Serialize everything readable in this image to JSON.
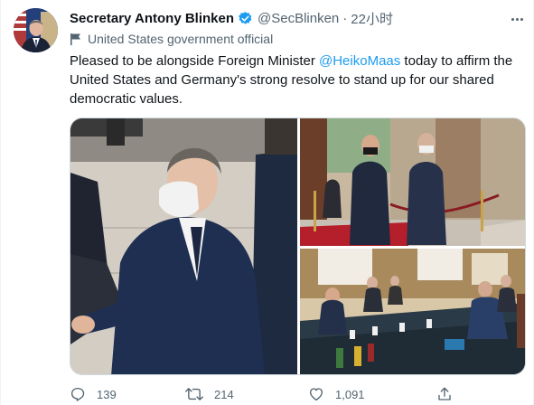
{
  "tweet": {
    "author_name": "Secretary Antony Blinken",
    "handle": "@SecBlinken",
    "separator": "·",
    "time": "22小时",
    "label": "United States government official",
    "text_before": "Pleased to be alongside Foreign Minister ",
    "mention": "@HeikoMaas",
    "text_after": " today to affirm the United States and Germany's strong resolve to stand up for our shared democratic values."
  },
  "actions": {
    "replies": "139",
    "retweets": "214",
    "likes": "1,091"
  },
  "icons": {
    "verified": "verified-badge-icon",
    "more": "more-icon",
    "official": "flag-icon",
    "reply": "reply-icon",
    "retweet": "retweet-icon",
    "like": "heart-icon",
    "share": "share-icon"
  },
  "colors": {
    "accent": "#1d9bf0",
    "secondary_text": "#536471",
    "primary_text": "#0f1419"
  }
}
